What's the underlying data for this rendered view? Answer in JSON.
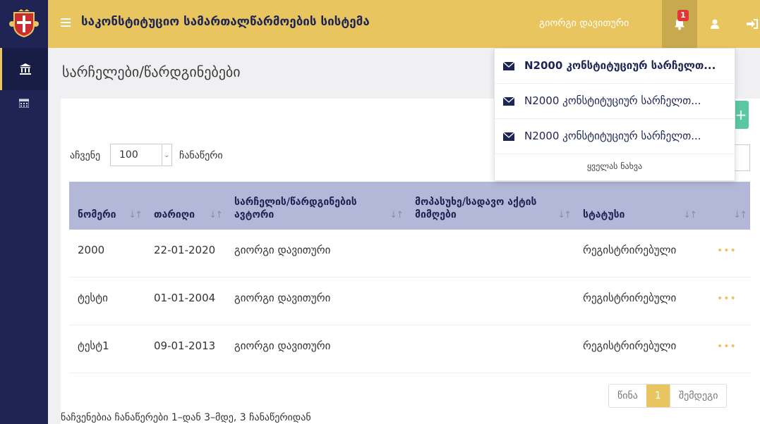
{
  "app": {
    "title": "საკონსტიტუციო სამართალწარმოების სისტემა",
    "user_name": "გიორგი დავითური",
    "notification_count": "1",
    "accent_color": "#e9c55f",
    "sidebar_color": "#1e2454"
  },
  "icons": {
    "logo": "georgia-coat-of-arms-icon",
    "menu": "hamburger-menu-icon",
    "bell": "bell-icon",
    "user": "user-icon",
    "logout": "sign-out-icon",
    "sidebar_home": "bank-building-icon",
    "sidebar_calendar": "calendar-icon"
  },
  "page": {
    "title": "სარჩელები/წარდგინებები"
  },
  "controls": {
    "show_label": "აჩვენე",
    "page_length": "100",
    "records_label": "ჩანაწერი",
    "add_label": "+"
  },
  "table": {
    "columns": [
      "ნომერი",
      "თარიღი",
      "სარჩელის/წარდგინების ავტორი",
      "მოპასუხე/სადავო აქტის მიმღები",
      "სტატუსი",
      ""
    ],
    "rows": [
      {
        "number": "2000",
        "date": "22-01-2020",
        "author": "გიორგი დავითური",
        "respondent": "",
        "status": "რეგისტრირებული"
      },
      {
        "number": "ტესტი",
        "date": "01-01-2004",
        "author": "გიორგი დავითური",
        "respondent": "",
        "status": "რეგისტრირებული"
      },
      {
        "number": "ტესტ1",
        "date": "09-01-2013",
        "author": "გიორგი დავითური",
        "respondent": "",
        "status": "რეგისტრირებული"
      }
    ],
    "actions_label": "•••"
  },
  "footer": {
    "info": "ნაჩვენებია ჩანაწერები 1–დან 3–მდე, 3 ჩანაწერიდან",
    "prev": "წინა",
    "current_page": "1",
    "next": "შემდეგი"
  },
  "notifications": {
    "items": [
      "N2000 კონსტიტუციურ სარჩელთ...",
      "N2000 კონსტიტუციურ სარჩელთ...",
      "N2000 კონსტიტუციურ სარჩელთ..."
    ],
    "view_all": "ყველას ნახვა"
  }
}
